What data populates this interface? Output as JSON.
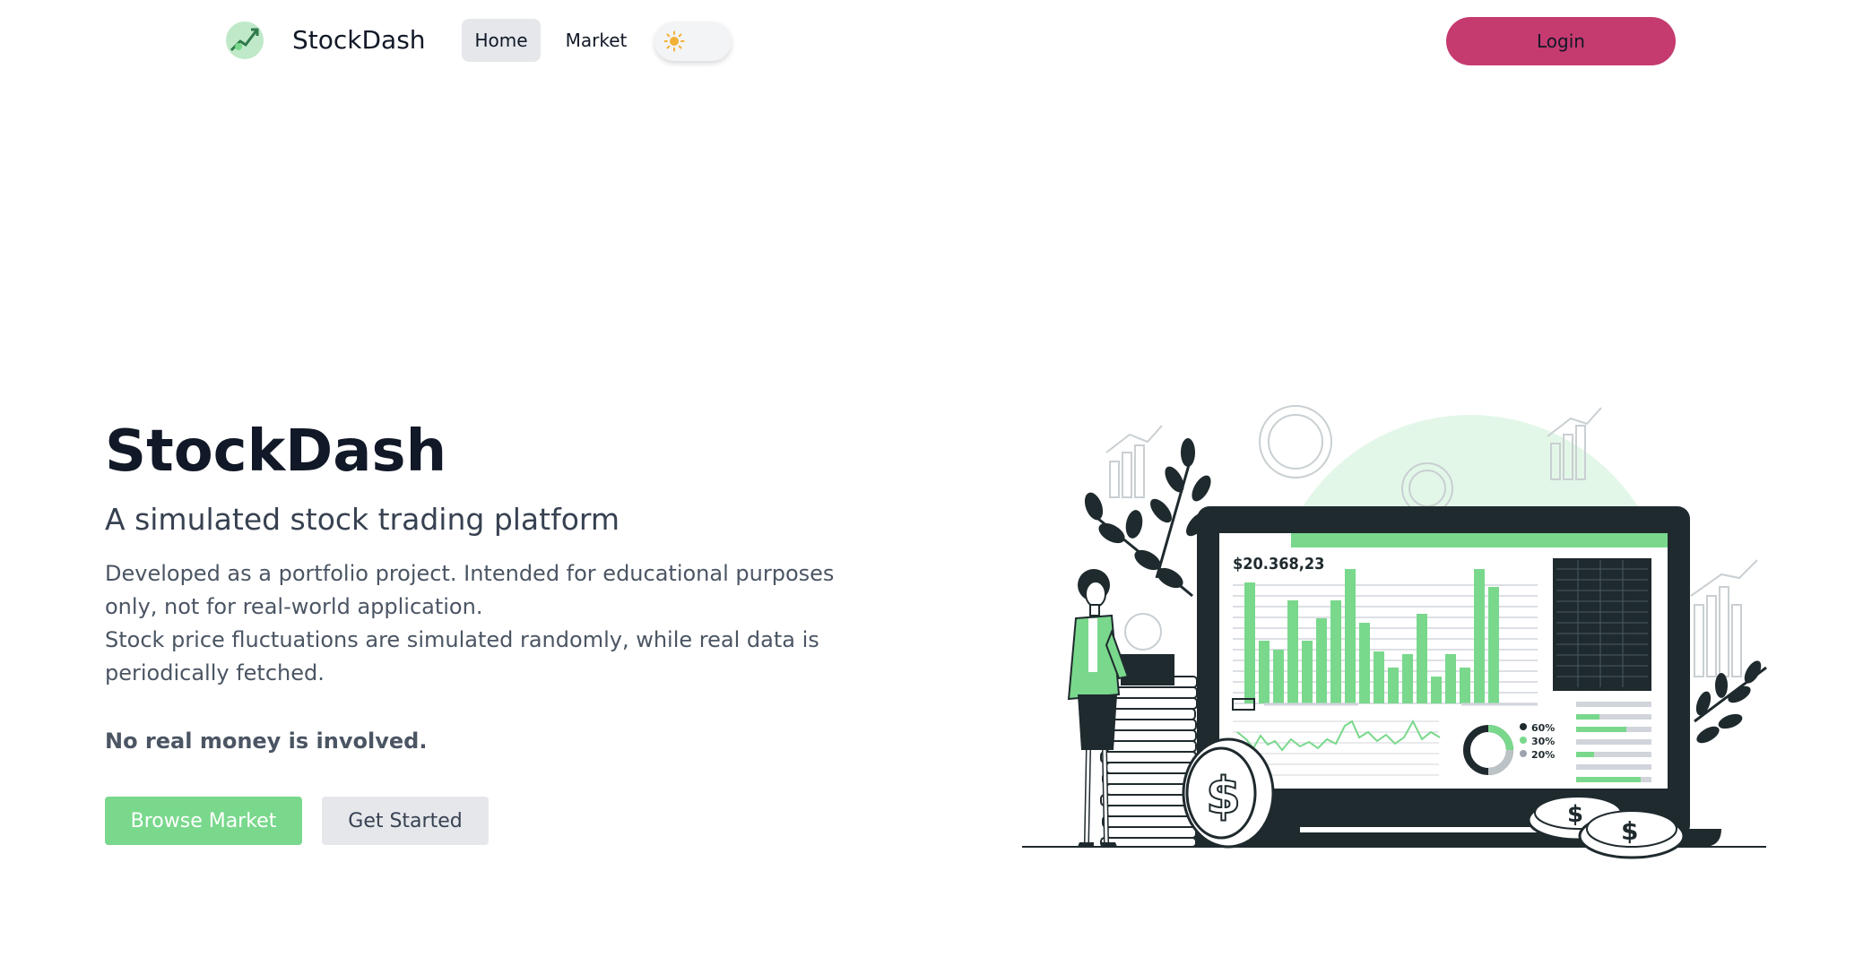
{
  "navbar": {
    "brand": "StockDash",
    "home_label": "Home",
    "market_label": "Market",
    "theme_icon": "sun-icon",
    "login_label": "Login"
  },
  "hero": {
    "title": "StockDash",
    "subtitle": "A simulated stock trading platform",
    "description_1": "Developed as a portfolio project. Intended for educational purposes only, not for real-world application.",
    "description_2": "Stock price fluctuations are simulated randomly, while real data is periodically fetched.",
    "note": "No real money is involved.",
    "browse_label": "Browse Market",
    "started_label": "Get Started"
  },
  "illustration": {
    "balance": "$20.368,23",
    "legend": [
      "60%",
      "30%",
      "20%"
    ]
  },
  "colors": {
    "accent_green": "#79d88c",
    "login_pink": "#c53a6f",
    "dark": "#1f2a2e",
    "mint": "#e3f7e8"
  }
}
